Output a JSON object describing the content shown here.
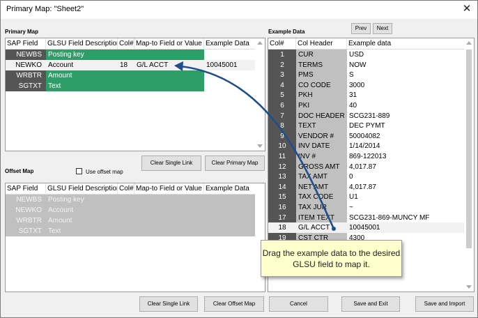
{
  "window": {
    "title": "Primary Map: \"Sheet2\"",
    "close_glyph": "✕"
  },
  "primary": {
    "label": "Primary Map",
    "columns": [
      "SAP Field",
      "GLSU Field Description",
      "Col#",
      "Map-to Field or Value",
      "Example Data"
    ],
    "rows": [
      {
        "sap": "NEWBS",
        "desc": "Posting key",
        "col": "",
        "map": "",
        "example": "",
        "style": "green"
      },
      {
        "sap": "NEWKO",
        "desc": "Account",
        "col": "18",
        "map": "G/L ACCT",
        "example": "10045001",
        "style": "selected"
      },
      {
        "sap": "WRBTR",
        "desc": "Amount",
        "col": "",
        "map": "",
        "example": "",
        "style": "green"
      },
      {
        "sap": "SGTXT",
        "desc": "Text",
        "col": "",
        "map": "",
        "example": "",
        "style": "green"
      }
    ],
    "clear_single_link": "Clear Single Link",
    "clear_primary_map": "Clear Primary Map"
  },
  "offset": {
    "label": "Offset Map",
    "use_offset_label": "Use offset map",
    "columns": [
      "SAP Field",
      "GLSU Field Description",
      "Col#",
      "Map-to Field or Value",
      "Example Data"
    ],
    "rows": [
      {
        "sap": "NEWBS",
        "desc": "Posting key"
      },
      {
        "sap": "NEWKO",
        "desc": "Account"
      },
      {
        "sap": "WRBTR",
        "desc": "Amount"
      },
      {
        "sap": "SGTXT",
        "desc": "Text"
      }
    ]
  },
  "example": {
    "label": "Example Data",
    "prev": "Prev",
    "next": "Next",
    "columns": [
      "Col#",
      "Col Header",
      "Example data"
    ],
    "rows": [
      {
        "n": "1",
        "h": "CUR",
        "v": "USD"
      },
      {
        "n": "2",
        "h": "TERMS",
        "v": "NOW"
      },
      {
        "n": "3",
        "h": "PMS",
        "v": "S"
      },
      {
        "n": "4",
        "h": "CO CODE",
        "v": "3000"
      },
      {
        "n": "5",
        "h": "PKH",
        "v": "31"
      },
      {
        "n": "6",
        "h": "PKI",
        "v": "40"
      },
      {
        "n": "7",
        "h": "DOC HEADER",
        "v": "SCG231-889"
      },
      {
        "n": "8",
        "h": "TEXT",
        "v": "DEC PYMT"
      },
      {
        "n": "9",
        "h": "VENDOR #",
        "v": "50004082"
      },
      {
        "n": "10",
        "h": "INV DATE",
        "v": "1/14/2014"
      },
      {
        "n": "11",
        "h": "INV #",
        "v": "869-122013"
      },
      {
        "n": "12",
        "h": "GROSS AMT",
        "v": "4,017.87"
      },
      {
        "n": "13",
        "h": "TAX AMT",
        "v": "0"
      },
      {
        "n": "14",
        "h": "NET AMT",
        "v": "4,017.87"
      },
      {
        "n": "15",
        "h": "TAX CODE",
        "v": "U1"
      },
      {
        "n": "16",
        "h": "TAX JUR",
        "v": "~"
      },
      {
        "n": "17",
        "h": "ITEM TEXT",
        "v": "SCG231-869-MUNCY MF"
      },
      {
        "n": "18",
        "h": "G/L ACCT",
        "v": "10045001",
        "selected": true
      },
      {
        "n": "19",
        "h": "CST CTR",
        "v": "4300"
      }
    ]
  },
  "footer": {
    "clear_single_link": "Clear Single Link",
    "clear_offset_map": "Clear Offset Map",
    "cancel": "Cancel",
    "save_and_exit": "Save and Exit",
    "save_and_import": "Save and Import"
  },
  "tooltip": {
    "text": "Drag the example data to the desired GLSU field to map it."
  },
  "colors": {
    "sap_cell": "#555555",
    "green": "#2e9e69",
    "gray": "#c0c0c0",
    "tooltip": "#ffffcc",
    "arrow": "#1f4e8c"
  }
}
